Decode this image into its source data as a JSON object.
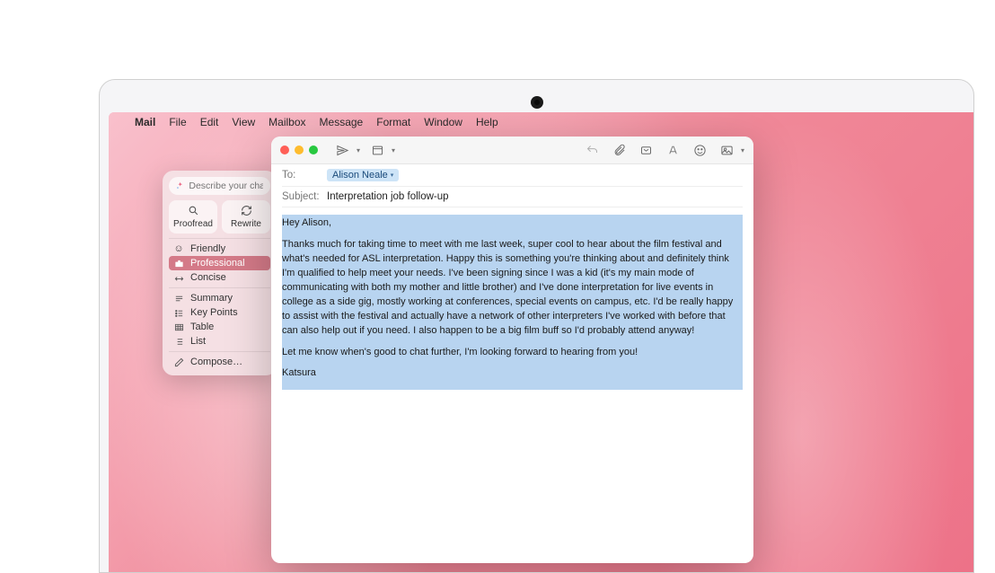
{
  "menubar": {
    "app": "Mail",
    "items": [
      "File",
      "Edit",
      "View",
      "Mailbox",
      "Message",
      "Format",
      "Window",
      "Help"
    ]
  },
  "writing_tools": {
    "placeholder": "Describe your change",
    "proofread": "Proofread",
    "rewrite": "Rewrite",
    "tones": [
      {
        "icon": "😊",
        "label": "Friendly",
        "selected": false
      },
      {
        "icon": "briefcase",
        "label": "Professional",
        "selected": true
      },
      {
        "icon": "arrows",
        "label": "Concise",
        "selected": false
      }
    ],
    "formats": [
      {
        "icon": "lines",
        "label": "Summary"
      },
      {
        "icon": "kp",
        "label": "Key Points"
      },
      {
        "icon": "table",
        "label": "Table"
      },
      {
        "icon": "list",
        "label": "List"
      }
    ],
    "compose": "Compose…"
  },
  "compose": {
    "to_label": "To:",
    "to_recipient": "Alison Neale",
    "subject_label": "Subject:",
    "subject_value": "Interpretation job follow-up",
    "greeting": "Hey Alison,",
    "body": "Thanks much for taking time to meet with me last week, super cool to hear about the film festival and what's needed for ASL interpretation. Happy this is something you're thinking about and definitely think I'm qualified to help meet your needs. I've been signing since I was a kid (it's my main mode of communicating with both my mother and little brother) and I've done interpretation for  live events in college as a side gig, mostly working at conferences, special events on campus, etc. I'd be really happy to assist with the festival and actually have a network of other interpreters I've worked with before that can also help out if you need. I also happen to be a big film buff so I'd probably attend anyway!",
    "closing": "Let me know when's good to chat further, I'm looking forward to hearing from you!",
    "signature": "Katsura"
  }
}
